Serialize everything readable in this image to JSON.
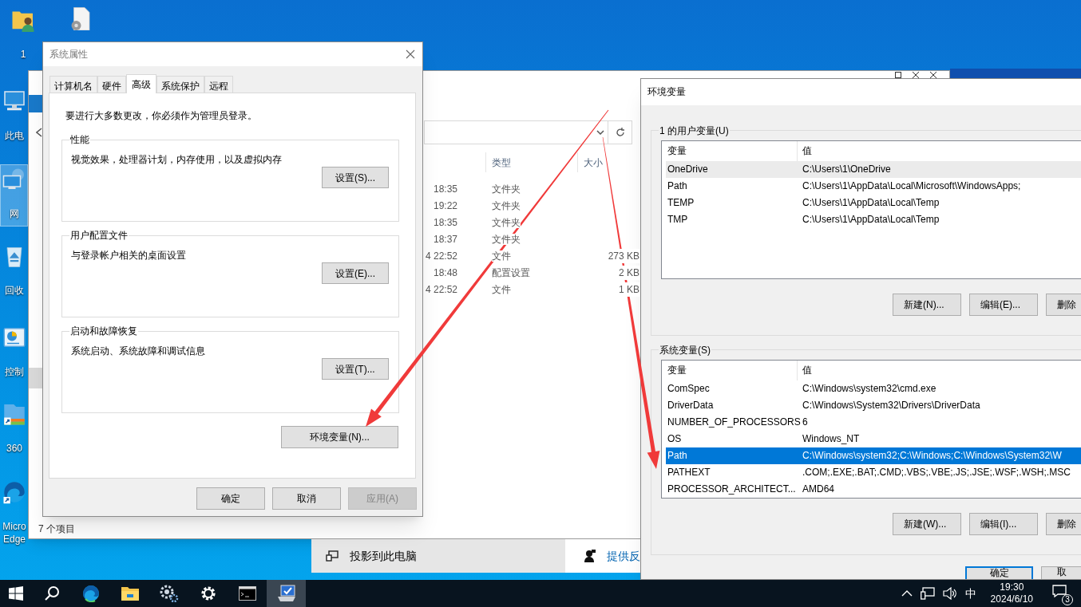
{
  "desktop_icons": [
    {
      "kind": "user-folder",
      "label": "1",
      "selected": false
    },
    {
      "kind": "settings-file",
      "selected": false
    },
    {
      "kind": "computer",
      "label": "此电",
      "selected": false
    },
    {
      "kind": "network",
      "label": "网",
      "selected": true
    },
    {
      "kind": "recycle-bin",
      "label": "回收",
      "selected": false
    },
    {
      "kind": "control-panel",
      "label": "控制",
      "selected": false
    },
    {
      "kind": "archive",
      "label": "360",
      "selected": false
    },
    {
      "kind": "edge",
      "label": "Micro Edge",
      "selected": false
    }
  ],
  "explorer": {
    "columns": [
      {
        "label": "类型"
      },
      {
        "label": "大小"
      }
    ],
    "files": [
      {
        "modified": "18:35",
        "type": "文件夹"
      },
      {
        "modified": "19:22",
        "type": "文件夹"
      },
      {
        "modified": "18:35",
        "type": "文件夹"
      },
      {
        "modified": "18:37",
        "type": "文件夹"
      },
      {
        "modified": "4 22:52",
        "type": "文件",
        "size": "273 KB"
      },
      {
        "modified": "18:48",
        "type": "配置设置",
        "size": "2 KB"
      },
      {
        "modified": "4 22:52",
        "type": "文件",
        "size": "1 KB"
      }
    ],
    "status": "7 个项目"
  },
  "settings_panel": {
    "item": "投影到此电脑",
    "link": "提供反"
  },
  "system_properties": {
    "title": "系统属性",
    "tabs": [
      {
        "label": "计算机名",
        "selected": false
      },
      {
        "label": "硬件",
        "selected": false
      },
      {
        "label": "高级",
        "selected": true
      },
      {
        "label": "系统保护",
        "selected": false
      },
      {
        "label": "远程",
        "selected": false
      }
    ],
    "notice": "要进行大多数更改，你必须作为管理员登录。",
    "groups": [
      {
        "title": "性能",
        "description": "视觉效果，处理器计划，内存使用，以及虚拟内存",
        "button": "设置(S)..."
      },
      {
        "title": "用户配置文件",
        "description": "与登录帐户相关的桌面设置",
        "button": "设置(E)..."
      },
      {
        "title": "启动和故障恢复",
        "description": "系统启动、系统故障和调试信息",
        "button": "设置(T)..."
      }
    ],
    "env_button": "环境变量(N)...",
    "buttons": [
      {
        "label": "确定",
        "disabled": false
      },
      {
        "label": "取消",
        "disabled": false
      },
      {
        "label": "应用(A)",
        "disabled": true
      }
    ]
  },
  "environment_variables": {
    "title": "环境变量",
    "tables": [
      {
        "title": "1 的用户变量(U)",
        "focused": false,
        "columns": [
          "变量",
          "值"
        ],
        "rows": [
          {
            "name": "OneDrive",
            "value": "C:\\Users\\1\\OneDrive",
            "selected": true
          },
          {
            "name": "Path",
            "value": "C:\\Users\\1\\AppData\\Local\\Microsoft\\WindowsApps;",
            "selected": false
          },
          {
            "name": "TEMP",
            "value": "C:\\Users\\1\\AppData\\Local\\Temp",
            "selected": false
          },
          {
            "name": "TMP",
            "value": "C:\\Users\\1\\AppData\\Local\\Temp",
            "selected": false
          }
        ],
        "buttons": [
          "新建(N)...",
          "编辑(E)...",
          "删除"
        ]
      },
      {
        "title": "系统变量(S)",
        "focused": true,
        "columns": [
          "变量",
          "值"
        ],
        "rows": [
          {
            "name": "ComSpec",
            "value": "C:\\Windows\\system32\\cmd.exe",
            "selected": false
          },
          {
            "name": "DriverData",
            "value": "C:\\Windows\\System32\\Drivers\\DriverData",
            "selected": false
          },
          {
            "name": "NUMBER_OF_PROCESSORS",
            "value": "6",
            "selected": false
          },
          {
            "name": "OS",
            "value": "Windows_NT",
            "selected": false
          },
          {
            "name": "Path",
            "value": "C:\\Windows\\system32;C:\\Windows;C:\\Windows\\System32\\W",
            "selected": true
          },
          {
            "name": "PATHEXT",
            "value": ".COM;.EXE;.BAT;.CMD;.VBS;.VBE;.JS;.JSE;.WSF;.WSH;.MSC",
            "selected": false
          },
          {
            "name": "PROCESSOR_ARCHITECT...",
            "value": "AMD64",
            "selected": false
          }
        ],
        "buttons": [
          "新建(W)...",
          "编辑(I)...",
          "删除"
        ]
      }
    ],
    "buttons": [
      {
        "label": "确定",
        "focused": true
      },
      {
        "label": "取",
        "focused": false
      }
    ]
  },
  "taskbar": {
    "apps": [
      {
        "kind": "start",
        "active": false
      },
      {
        "kind": "search",
        "active": false
      },
      {
        "kind": "edge",
        "active": false
      },
      {
        "kind": "folder",
        "active": false
      },
      {
        "kind": "cogs",
        "active": false
      },
      {
        "kind": "gear",
        "active": false
      },
      {
        "kind": "terminal",
        "active": false
      },
      {
        "kind": "system-properties",
        "active": true
      }
    ],
    "ime": "中",
    "time": "19:30",
    "date": "2024/6/10",
    "notifications": "3"
  }
}
